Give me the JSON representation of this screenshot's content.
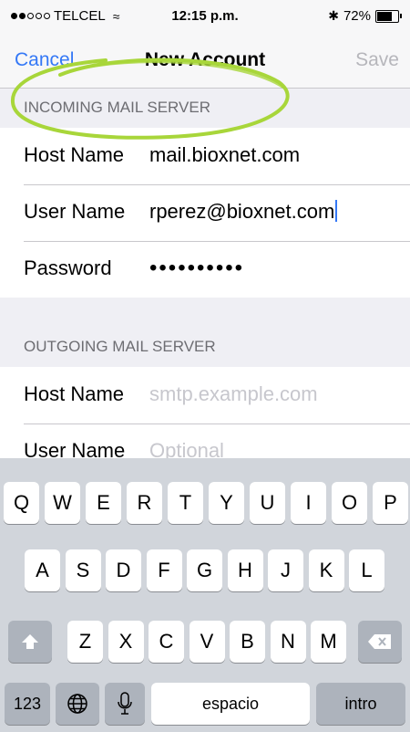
{
  "status_bar": {
    "carrier": "TELCEL",
    "time": "12:15 p.m.",
    "battery_percent": "72%",
    "battery_level": 0.72
  },
  "nav": {
    "cancel": "Cancel",
    "title": "New Account",
    "save": "Save"
  },
  "incoming": {
    "header": "INCOMING MAIL SERVER",
    "host_label": "Host Name",
    "host_value": "mail.bioxnet.com",
    "user_label": "User Name",
    "user_value": "rperez@bioxnet.com",
    "password_label": "Password",
    "password_value": "••••••••••"
  },
  "outgoing": {
    "header": "OUTGOING MAIL SERVER",
    "host_label": "Host Name",
    "host_placeholder": "smtp.example.com",
    "user_label": "User Name",
    "user_placeholder": "Optional"
  },
  "keyboard": {
    "row1": [
      "Q",
      "W",
      "E",
      "R",
      "T",
      "Y",
      "U",
      "I",
      "O",
      "P"
    ],
    "row2": [
      "A",
      "S",
      "D",
      "F",
      "G",
      "H",
      "J",
      "K",
      "L"
    ],
    "row3": [
      "Z",
      "X",
      "C",
      "V",
      "B",
      "N",
      "M"
    ],
    "numbers_key": "123",
    "space_key": "espacio",
    "return_key": "intro",
    "icons": [
      "shift-icon",
      "delete-icon",
      "globe-icon",
      "microphone-icon"
    ]
  },
  "colors": {
    "accent": "#3478f6",
    "annotation": "#a8d63a",
    "placeholder": "#c7c7cd"
  }
}
